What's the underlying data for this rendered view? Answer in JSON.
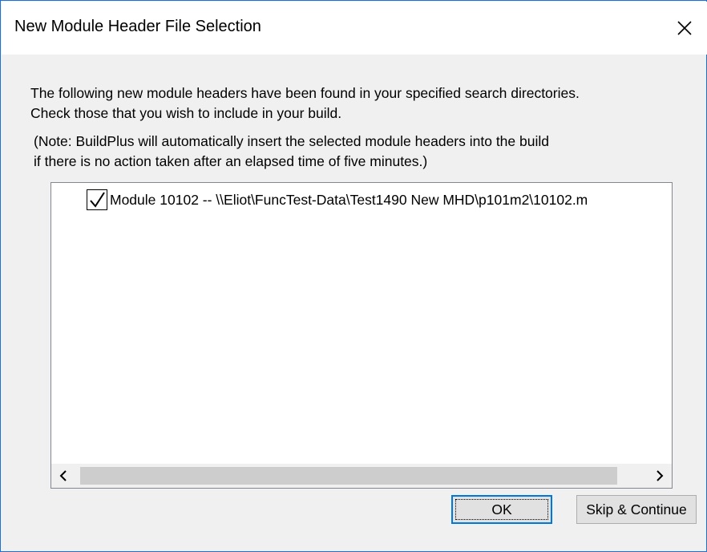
{
  "window": {
    "title": "New Module Header File Selection",
    "close_icon": "close-icon"
  },
  "message": {
    "line1": "The following new module headers have been found in your specified search directories.",
    "line2": "Check those that you wish to include in your build.",
    "note_line1": "(Note:  BuildPlus will automatically insert the selected module headers into the build",
    "note_line2": " if there is no action taken after an elapsed time of five minutes.)"
  },
  "list": {
    "items": [
      {
        "checked": true,
        "label": "Module 10102 -- \\\\Eliot\\FuncTest-Data\\Test1490 New MHD\\p101m2\\10102.m"
      }
    ]
  },
  "buttons": {
    "ok_label": "OK",
    "skip_label": "Skip & Continue"
  },
  "colors": {
    "accent": "#0078d7",
    "window_border": "#1e6fd9",
    "dialog_bg": "#f0f0f0"
  }
}
